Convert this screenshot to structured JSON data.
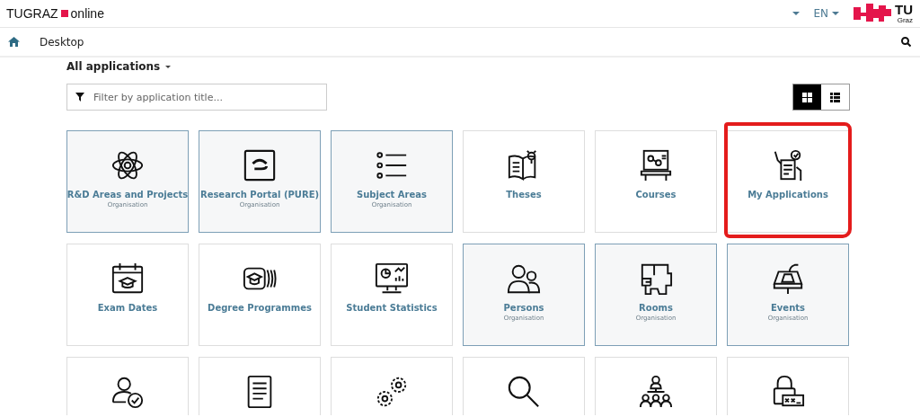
{
  "header": {
    "brand_left": "TUGRAZ",
    "brand_right": "online",
    "language": "EN",
    "logo_text": "TU",
    "logo_subtext": "Graz"
  },
  "nav": {
    "title": "Desktop"
  },
  "section": {
    "title": "All applications"
  },
  "filter": {
    "placeholder": "Filter by application title..."
  },
  "view_toggle": [
    {
      "selected": true
    },
    {
      "selected": false
    }
  ],
  "tiles": [
    {
      "kind": "organisation",
      "label": "R&D Areas and Projects",
      "subtitle": "Organisation",
      "marked": false
    },
    {
      "kind": "organisation",
      "label": "Research Portal (PURE)",
      "subtitle": "Organisation",
      "marked": false
    },
    {
      "kind": "organisation",
      "label": "Subject Areas",
      "subtitle": "Organisation",
      "marked": false
    },
    {
      "kind": "standard",
      "label": "Theses",
      "marked": false
    },
    {
      "kind": "standard",
      "label": "Courses",
      "marked": false
    },
    {
      "kind": "standard",
      "label": "My Applications",
      "marked": true
    },
    {
      "kind": "standard",
      "label": "Exam Dates",
      "marked": false
    },
    {
      "kind": "standard",
      "label": "Degree Programmes",
      "marked": false
    },
    {
      "kind": "standard",
      "label": "Student Statistics",
      "marked": false
    },
    {
      "kind": "organisation",
      "label": "Persons",
      "subtitle": "Organisation",
      "marked": false
    },
    {
      "kind": "organisation",
      "label": "Rooms",
      "subtitle": "Organisation",
      "marked": false
    },
    {
      "kind": "organisation",
      "label": "Events",
      "subtitle": "Organisation",
      "marked": false
    },
    {
      "kind": "standard",
      "marked": false
    },
    {
      "kind": "standard",
      "marked": false
    },
    {
      "kind": "standard",
      "marked": false
    },
    {
      "kind": "standard",
      "marked": false
    },
    {
      "kind": "standard",
      "marked": false
    },
    {
      "kind": "standard",
      "marked": false
    }
  ]
}
